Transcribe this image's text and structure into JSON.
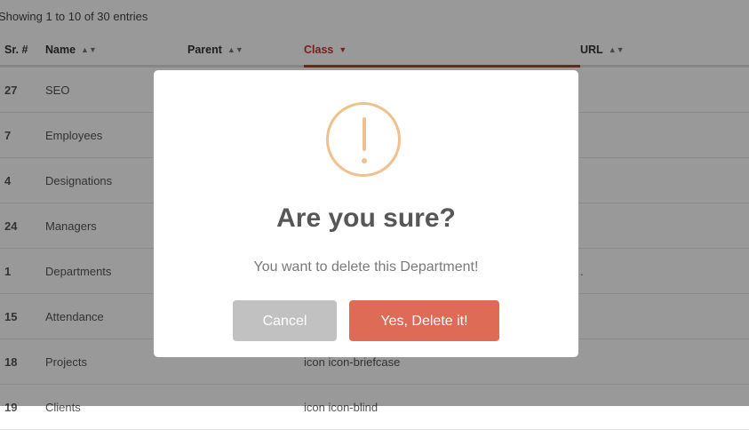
{
  "table": {
    "info": "Showing 1 to 10 of 30 entries",
    "columns": [
      "Sr. #",
      "Name",
      "Parent",
      "Class",
      "URL"
    ],
    "rows": [
      {
        "sr": "27",
        "name": "SEO",
        "parent": "",
        "class": "",
        "url": ""
      },
      {
        "sr": "7",
        "name": "Employees",
        "parent": "",
        "class": "",
        "url": ""
      },
      {
        "sr": "4",
        "name": "Designations",
        "parent": "",
        "class": "",
        "url": ""
      },
      {
        "sr": "24",
        "name": "Managers",
        "parent": "",
        "class": "",
        "url": ""
      },
      {
        "sr": "1",
        "name": "Departments",
        "parent": "",
        "class": "",
        "url": "."
      },
      {
        "sr": "15",
        "name": "Attendance",
        "parent": "",
        "class": "",
        "url": ""
      },
      {
        "sr": "18",
        "name": "Projects",
        "parent": "",
        "class": "icon icon-briefcase",
        "url": ""
      },
      {
        "sr": "19",
        "name": "Clients",
        "parent": "",
        "class": "icon icon-blind",
        "url": ""
      }
    ]
  },
  "dialog": {
    "title": "Are you sure?",
    "text": "You want to delete this Department!",
    "cancel_label": "Cancel",
    "confirm_label": "Yes, Delete it!",
    "icon": "warning-icon"
  },
  "colors": {
    "accent": "#c0392b",
    "warning": "#f0c08d",
    "confirm": "#dd6b55",
    "cancel": "#c1c1c1"
  }
}
